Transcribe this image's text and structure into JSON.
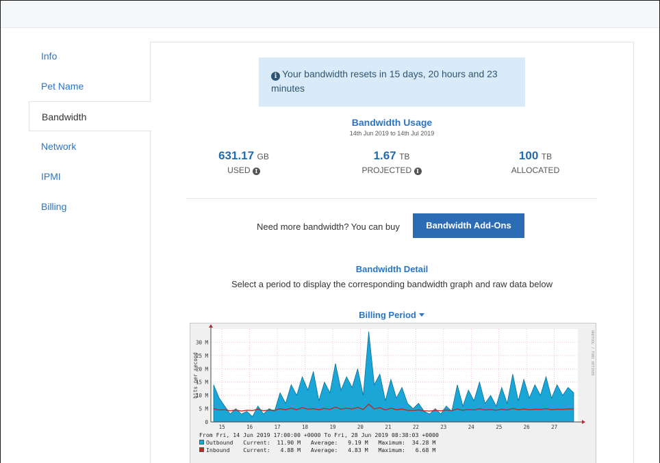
{
  "sidebar": {
    "items": [
      {
        "label": "Info",
        "active": false
      },
      {
        "label": "Pet Name",
        "active": false
      },
      {
        "label": "Bandwidth",
        "active": true
      },
      {
        "label": "Network",
        "active": false
      },
      {
        "label": "IPMI",
        "active": false
      },
      {
        "label": "Billing",
        "active": false
      }
    ]
  },
  "alert": {
    "text": "Your bandwidth resets in 15 days, 20 hours and 23 minutes",
    "icon": "info-circle-icon"
  },
  "usage": {
    "title": "Bandwidth Usage",
    "dates": "14th Jun 2019 to 14th Jul 2019",
    "used": {
      "value": "631.17",
      "unit": "GB",
      "label": "USED"
    },
    "projected": {
      "value": "1.67",
      "unit": "TB",
      "label": "PROJECTED"
    },
    "allocated": {
      "value": "100",
      "unit": "TB",
      "label": "ALLOCATED"
    }
  },
  "buy": {
    "text": "Need more bandwidth? You can buy",
    "button": "Bandwidth Add-Ons"
  },
  "detail": {
    "title": "Bandwidth Detail",
    "subtitle": "Select a period to display the corresponding bandwidth graph and raw data below"
  },
  "period_selector": {
    "label": "Billing Period"
  },
  "colors": {
    "accent": "#2a74c6",
    "button": "#2b6cb5",
    "outbound": "#1aa6d6",
    "inbound": "#c0281e"
  },
  "chart_data": {
    "type": "area",
    "ylabel": "bits per second",
    "watermark": "RRDTOOL / TOBI OETIKER",
    "y_ticks": [
      "0",
      "5 M",
      "10 M",
      "15 M",
      "20 M",
      "25 M",
      "30 M"
    ],
    "x_ticks": [
      "15",
      "16",
      "17",
      "18",
      "19",
      "20",
      "21",
      "22",
      "23",
      "24",
      "25",
      "26",
      "27"
    ],
    "ylim": [
      0,
      35
    ],
    "grid": true,
    "range_text": "From Fri, 14 Jun 2019 17:00:00 +0000 To Fri, 28 Jun 2019 08:38:03 +0000",
    "x": [
      14.7,
      14.9,
      15.1,
      15.3,
      15.5,
      15.7,
      15.9,
      16.1,
      16.3,
      16.5,
      16.7,
      16.9,
      17.1,
      17.3,
      17.5,
      17.7,
      17.9,
      18.1,
      18.3,
      18.5,
      18.7,
      18.9,
      19.1,
      19.3,
      19.5,
      19.7,
      19.9,
      20.1,
      20.3,
      20.5,
      20.7,
      20.9,
      21.1,
      21.3,
      21.5,
      21.7,
      21.9,
      22.1,
      22.3,
      22.5,
      22.7,
      22.9,
      23.1,
      23.3,
      23.5,
      23.7,
      23.9,
      24.1,
      24.3,
      24.5,
      24.7,
      24.9,
      25.1,
      25.3,
      25.5,
      25.7,
      25.9,
      26.1,
      26.3,
      26.5,
      26.7,
      26.9,
      27.1,
      27.3,
      27.5,
      27.7
    ],
    "series": [
      {
        "name": "Outbound",
        "current": "11.90 M",
        "average": "9.19 M",
        "maximum": "34.28 M",
        "values": [
          14,
          9,
          6,
          3,
          5,
          3,
          4,
          2,
          6,
          3,
          5,
          4,
          11,
          7,
          14,
          10,
          17,
          12,
          19,
          8,
          15,
          11,
          22,
          12,
          17,
          13,
          20,
          10,
          34,
          14,
          18,
          8,
          16,
          9,
          13,
          7,
          5,
          7,
          4,
          3,
          5,
          3,
          6,
          4,
          14,
          6,
          12,
          8,
          15,
          7,
          10,
          6,
          13,
          7,
          18,
          8,
          16,
          9,
          14,
          10,
          17,
          9,
          14,
          10,
          13,
          11
        ]
      },
      {
        "name": "Inbound",
        "current": "4.88 M",
        "average": "4.83 M",
        "maximum": "6.68 M",
        "values": [
          5,
          4.5,
          4.6,
          4.2,
          4.5,
          4.1,
          4.4,
          4.3,
          4.8,
          4.2,
          4.5,
          4.4,
          5,
          4.6,
          5.2,
          4.6,
          5.4,
          4.8,
          5,
          4.6,
          5.1,
          4.7,
          5.6,
          4.8,
          5.2,
          4.9,
          5.5,
          4.7,
          6.7,
          4.9,
          5.4,
          4.5,
          5.2,
          4.6,
          4.9,
          4.4,
          4.3,
          4.5,
          4.2,
          4.1,
          4.4,
          4.2,
          4.5,
          4.3,
          4.9,
          4.4,
          4.7,
          4.5,
          5,
          4.5,
          4.7,
          4.4,
          4.8,
          4.5,
          5.1,
          4.6,
          4.9,
          4.6,
          4.8,
          4.7,
          5,
          4.6,
          4.8,
          4.7,
          4.9,
          4.9
        ]
      }
    ],
    "legend_labels": {
      "current": "Current:",
      "average": "Average:",
      "maximum": "Maximum:"
    }
  }
}
